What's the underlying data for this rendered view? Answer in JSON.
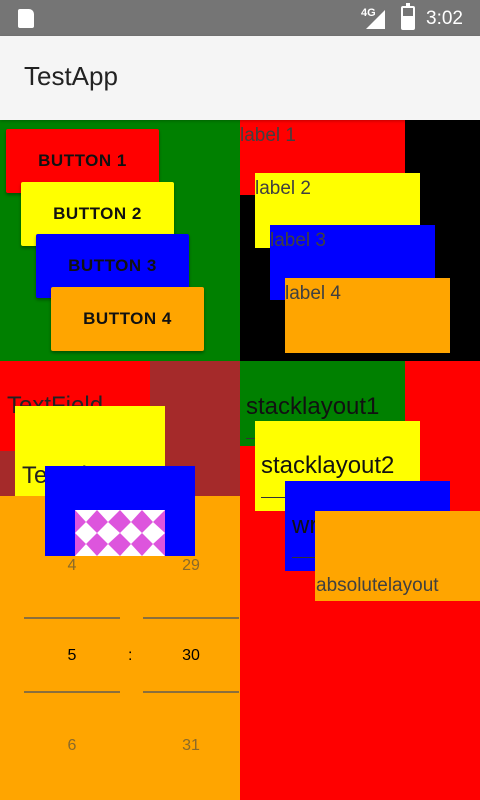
{
  "status_bar": {
    "network": "4G",
    "time": "3:02"
  },
  "toolbar": {
    "title": "TestApp"
  },
  "colors": {
    "status_bar": "#757575",
    "toolbar": "#f5f5f5",
    "green": "#008000",
    "red": "#ff0000",
    "yellow": "#ffff00",
    "blue": "#0000ff",
    "orange": "#ffa500",
    "brown": "#a52a2a",
    "black": "#000000"
  },
  "buttons": [
    {
      "label": "BUTTON 1"
    },
    {
      "label": "BUTTON 2"
    },
    {
      "label": "BUTTON 3"
    },
    {
      "label": "BUTTON 4"
    }
  ],
  "labels": [
    {
      "text": "label 1"
    },
    {
      "text": "label 2"
    },
    {
      "text": "label 3"
    },
    {
      "text": "label 4"
    }
  ],
  "text_field": "TextField",
  "text_view": "TextView",
  "time_picker": {
    "hours": {
      "prev": "4",
      "current": "5",
      "next": "6"
    },
    "separator": ":",
    "minutes": {
      "prev": "29",
      "current": "30",
      "next": "31"
    }
  },
  "layouts": {
    "stack1": "stacklayout1",
    "stack2": "stacklayout2",
    "wrap": "wraplayout",
    "absolute": "absolutelayout"
  }
}
